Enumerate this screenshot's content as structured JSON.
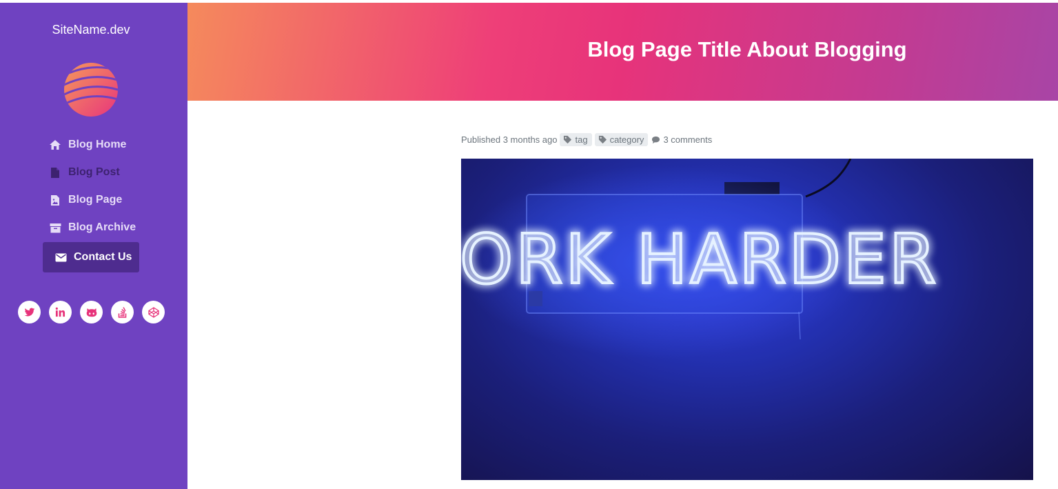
{
  "site": {
    "name": "SiteName.dev"
  },
  "nav": {
    "items": [
      {
        "label": "Blog Home",
        "icon": "home-icon"
      },
      {
        "label": "Blog Post",
        "icon": "file-icon"
      },
      {
        "label": "Blog Page",
        "icon": "file-image-icon"
      },
      {
        "label": "Blog Archive",
        "icon": "archive-icon"
      },
      {
        "label": "Contact Us",
        "icon": "envelope-icon",
        "active": true
      }
    ]
  },
  "social": [
    "twitter-icon",
    "linkedin-icon",
    "github-icon",
    "stackoverflow-icon",
    "codepen-icon"
  ],
  "header": {
    "title": "Blog Page Title About Blogging"
  },
  "post": {
    "published": "Published 3 months ago",
    "tag": "tag",
    "category": "category",
    "comments": "3 comments"
  },
  "hero": {
    "sign_text": "WORK HARDER"
  },
  "colors": {
    "sidebar": "#6f42c1",
    "active_nav": "#4e2c8f",
    "accent": "#e7337a",
    "gradient_start": "#f58a5c",
    "gradient_end": "#a845a6"
  }
}
